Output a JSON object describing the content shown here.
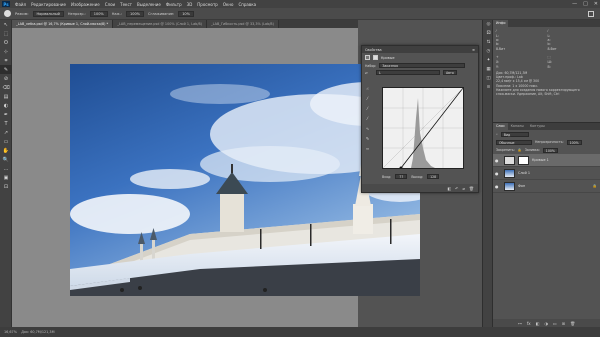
{
  "app": {
    "logo": "Ps"
  },
  "menu": [
    "Файл",
    "Редактирование",
    "Изображение",
    "Слои",
    "Текст",
    "Выделение",
    "Фильтр",
    "3D",
    "Просмотр",
    "Окно",
    "Справка"
  ],
  "window_controls": {
    "minimize": "—",
    "maximize": "□",
    "close": "✕"
  },
  "options": {
    "mode_label": "Режим:",
    "mode_value": "Нормальный",
    "opacity_label": "Непрозр.:",
    "opacity_value": "100%",
    "flow_label": "Наж.:",
    "flow_value": "100%",
    "smooth_label": "Сглаживание:",
    "smooth_value": "10%"
  },
  "tabs": [
    {
      "label": "_LAB_vetka.psd @ 16,7% (Кривые 1, Слой-маска/8) *",
      "active": true
    },
    {
      "label": "_LAB_перемещение.psd @ 100% (Слой 1, Lab/8)",
      "active": false
    },
    {
      "label": "_LAB_Гибкость.psd @ 33,3% (Lab/8)",
      "active": false
    }
  ],
  "tools": [
    "↖",
    "⬚",
    "ʘ",
    "⊹",
    "⌗",
    "✎",
    "⊘",
    "⌫",
    "▤",
    "◐",
    "✒",
    "T",
    "↗",
    "▭",
    "✋",
    "🔍",
    "…",
    "▣",
    "⊡"
  ],
  "active_tool_index": 5,
  "status": {
    "zoom": "16,67%",
    "doc": "Док: 60,7M/121,3M"
  },
  "properties": {
    "title": "Свойства",
    "layer_type": "Кривые",
    "preset_label": "Набор:",
    "preset_value": "Заказная",
    "channel_value": "L",
    "auto_label": "Авто",
    "input_label": "Вход:",
    "input_value": "77",
    "output_label": "Выход:",
    "output_value": "128",
    "icons": [
      "hand-point",
      "eyedropper-black",
      "eyedropper-gray",
      "eyedropper-white",
      "curve-pencil",
      "pencil-icon",
      "smooth-icon"
    ],
    "footer_icons": [
      "◧",
      "↶",
      "⌀",
      "🗑"
    ]
  },
  "right_icons": [
    "◎",
    "⚄",
    "⇅",
    "◷",
    "✦",
    "▦",
    "◫",
    "≡"
  ],
  "info": {
    "tab": "Инфо",
    "cell_a": "L:\na:\nb:",
    "cell_b": "L:\na:\nb:",
    "bit_a": "8-бит",
    "bit_b": "8-бит",
    "x_label": "X:",
    "y_label": "Y:",
    "w_label": "Ш:",
    "h_label": "В:",
    "lines": [
      "Док: 60,7M/121,3M",
      "Цвет.проф.: Lab",
      "22,4 мм/г x 15,4 см @ 300",
      "Пиксели: 1 x 10000 пикс.",
      "",
      "Нажмите для создания нового корректирующего",
      "слоя-маски. Удержание, Alt, Shift, Ctrl"
    ]
  },
  "layers": {
    "tabs": [
      "Слои",
      "Каналы",
      "Контуры"
    ],
    "kind_label": "Вид",
    "blend_value": "Обычные",
    "opacity_label": "Непрозрачность:",
    "opacity_value": "100%",
    "lock_label": "Закрепить:",
    "fill_label": "Заливка:",
    "fill_value": "100%",
    "items": [
      {
        "name": "Кривые 1",
        "selected": true,
        "type": "adjustment"
      },
      {
        "name": "Слой 1",
        "selected": false,
        "type": "photo"
      },
      {
        "name": "Фон",
        "selected": false,
        "type": "photo-bg"
      }
    ],
    "footer_icons": [
      "⊶",
      "fx",
      "◧",
      "◑",
      "▭",
      "⊞",
      "🗑"
    ]
  }
}
